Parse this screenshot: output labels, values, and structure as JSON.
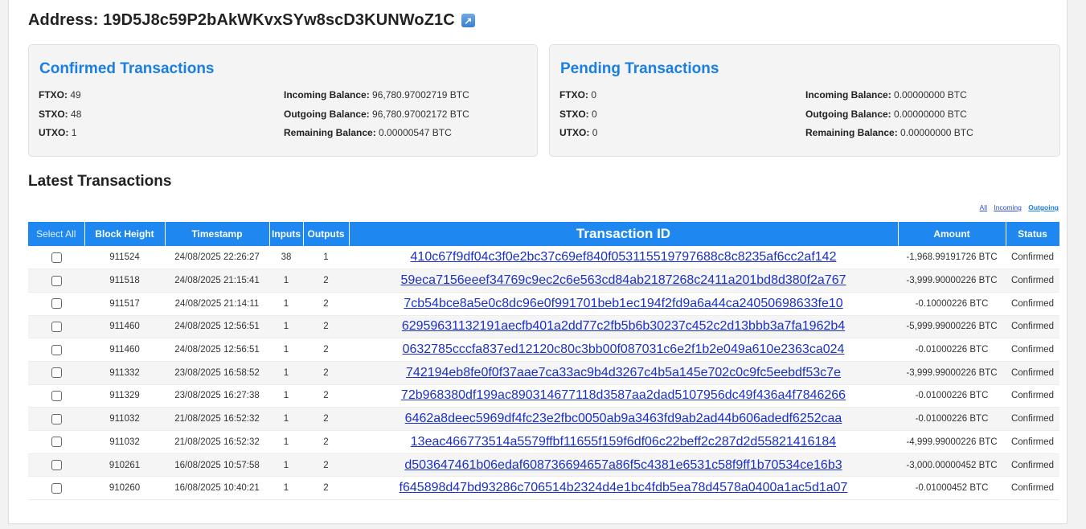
{
  "address": {
    "title": "Address: 19D5J8c59P2bAkWKvxSYw8scD3KUNWoZ1C",
    "external_link_icon": "external-link-icon"
  },
  "confirmed": {
    "heading": "Confirmed Transactions",
    "ftxo_label": "FTXO:",
    "ftxo": "49",
    "stxo_label": "STXO:",
    "stxo": "48",
    "utxo_label": "UTXO:",
    "utxo": "1",
    "incoming_label": "Incoming Balance:",
    "incoming": "96,780.97002719 BTC",
    "outgoing_label": "Outgoing Balance:",
    "outgoing": "96,780.97002172 BTC",
    "remaining_label": "Remaining Balance:",
    "remaining": "0.00000547 BTC"
  },
  "pending": {
    "heading": "Pending Transactions",
    "ftxo_label": "FTXO:",
    "ftxo": "0",
    "stxo_label": "STXO:",
    "stxo": "0",
    "utxo_label": "UTXO:",
    "utxo": "0",
    "incoming_label": "Incoming Balance:",
    "incoming": "0.00000000 BTC",
    "outgoing_label": "Outgoing Balance:",
    "outgoing": "0.00000000 BTC",
    "remaining_label": "Remaining Balance:",
    "remaining": "0.00000000 BTC"
  },
  "latest": {
    "heading": "Latest Transactions",
    "filters": {
      "all": "All",
      "incoming": "Incoming",
      "outgoing": "Outgoing",
      "active": "outgoing"
    }
  },
  "table": {
    "columns": [
      "Select All",
      "Block Height",
      "Timestamp",
      "Inputs",
      "Outputs",
      "Transaction ID",
      "Amount",
      "Status"
    ],
    "rows": [
      {
        "block": "911524",
        "ts": "24/08/2025 22:26:27",
        "in": "38",
        "out": "1",
        "txid": "410c67f9df04c3f0e2bc37c69ef840f053115519797688c8c8235af6cc2af142",
        "amount": "-1,968.99191726 BTC",
        "status": "Confirmed"
      },
      {
        "block": "911518",
        "ts": "24/08/2025 21:15:41",
        "in": "1",
        "out": "2",
        "txid": "59eca7156eeef34769c9ec2c6e563cd84ab2187268c2411a201bd8d380f2a767",
        "amount": "-3,999.90000226 BTC",
        "status": "Confirmed"
      },
      {
        "block": "911517",
        "ts": "24/08/2025 21:14:11",
        "in": "1",
        "out": "2",
        "txid": "7cb54bce8a5e0c8dc96e0f991701beb1ec194f2fd9a6a44ca24050698633fe10",
        "amount": "-0.10000226 BTC",
        "status": "Confirmed"
      },
      {
        "block": "911460",
        "ts": "24/08/2025 12:56:51",
        "in": "1",
        "out": "2",
        "txid": "62959631132191aecfb401a2dd77c2fb5b6b30237c452c2d13bbb3a7fa1962b4",
        "amount": "-5,999.99000226 BTC",
        "status": "Confirmed"
      },
      {
        "block": "911460",
        "ts": "24/08/2025 12:56:51",
        "in": "1",
        "out": "2",
        "txid": "0632785cccfa837ed12120c80c3bb00f087031c6e2f1b2e049a610e2363ca024",
        "amount": "-0.01000226 BTC",
        "status": "Confirmed"
      },
      {
        "block": "911332",
        "ts": "23/08/2025 16:58:52",
        "in": "1",
        "out": "2",
        "txid": "742194eb8fe0f0f37aae7ca33ac9b4d3267c4b5a145e702c0c9fc5eebdf53c7e",
        "amount": "-3,999.99000226 BTC",
        "status": "Confirmed"
      },
      {
        "block": "911329",
        "ts": "23/08/2025 16:27:38",
        "in": "1",
        "out": "2",
        "txid": "72b968380df199ac890314677118d3587aa2dad5107956dc49f436a4f7846266",
        "amount": "-0.01000226 BTC",
        "status": "Confirmed"
      },
      {
        "block": "911032",
        "ts": "21/08/2025 16:52:32",
        "in": "1",
        "out": "2",
        "txid": "6462a8deec5969df4fc23e2fbc0050ab9a3463fd9ab2ad44b606adedf6252caa",
        "amount": "-0.01000226 BTC",
        "status": "Confirmed"
      },
      {
        "block": "911032",
        "ts": "21/08/2025 16:52:32",
        "in": "1",
        "out": "2",
        "txid": "13eac466773514a5579ffbf11655f159f6df06c22beff2c287d2d55821416184",
        "amount": "-4,999.99000226 BTC",
        "status": "Confirmed"
      },
      {
        "block": "910261",
        "ts": "16/08/2025 10:57:58",
        "in": "1",
        "out": "2",
        "txid": "d503647461b06edaf608736694657a86f5c4381e6531c58f9ff1b70534ce16b3",
        "amount": "-3,000.00000452 BTC",
        "status": "Confirmed"
      },
      {
        "block": "910260",
        "ts": "16/08/2025 10:40:21",
        "in": "1",
        "out": "2",
        "txid": "f645898d47bd93286c706514b2324d4e1bc4fdb5ea78d4578a0400a1ac5d1a07",
        "amount": "-0.01000452 BTC",
        "status": "Confirmed"
      }
    ]
  },
  "colors": {
    "accent": "#1e88f0",
    "heading_blue": "#1a7fe0",
    "link": "#1a30c8"
  }
}
